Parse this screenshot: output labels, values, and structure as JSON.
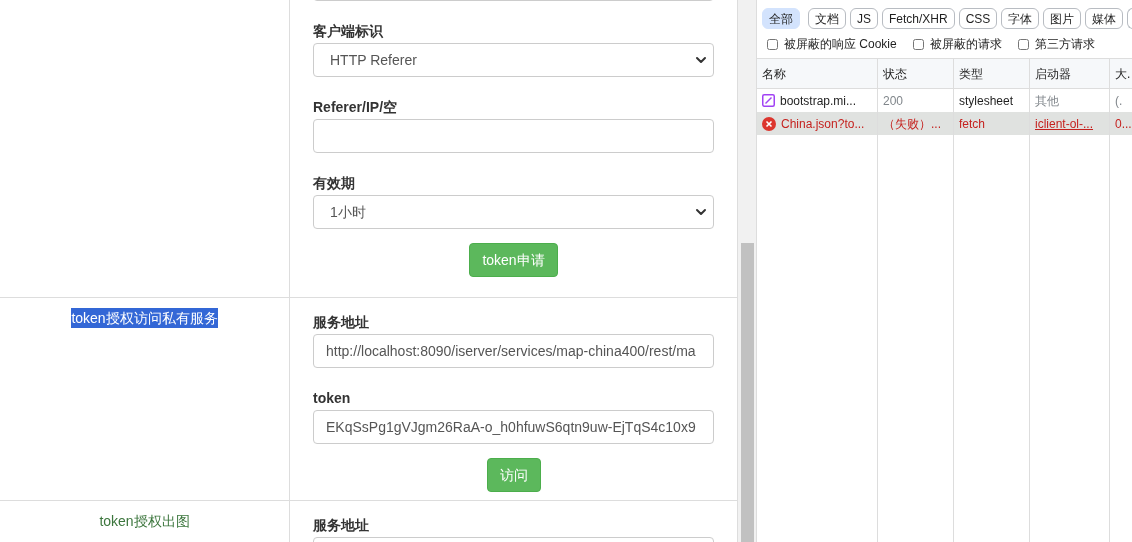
{
  "form_rows": [
    {
      "title": null,
      "fields": [
        {
          "kind": "input"
        },
        {
          "label": "客户端标识",
          "kind": "select",
          "value": "HTTP Referer"
        },
        {
          "label": "Referer/IP/空",
          "kind": "input"
        },
        {
          "label": "有效期",
          "kind": "select",
          "value": "1小时"
        }
      ],
      "button": "token申请"
    },
    {
      "title": "token授权访问私有服务",
      "title_selected": true,
      "fields": [
        {
          "label": "服务地址",
          "kind": "input",
          "value": "http://localhost:8090/iserver/services/map-china400/rest/ma"
        },
        {
          "label": "token",
          "kind": "input",
          "value": "EKqSsPg1gVJgm26RaA-o_h0hfuwS6qtn9uw-EjTqS4c10x9"
        }
      ],
      "button": "访问"
    },
    {
      "title": "token授权出图",
      "title_selected": false,
      "fields": [
        {
          "label": "服务地址",
          "kind": "input"
        }
      ],
      "button": null
    }
  ],
  "devtools": {
    "filters": [
      {
        "label": "全部",
        "selected": true
      },
      {
        "label": "文档",
        "selected": false
      },
      {
        "label": "JS",
        "selected": false
      },
      {
        "label": "Fetch/XHR",
        "selected": false
      },
      {
        "label": "CSS",
        "selected": false
      },
      {
        "label": "字体",
        "selected": false
      },
      {
        "label": "图片",
        "selected": false
      },
      {
        "label": "媒体",
        "selected": false
      }
    ],
    "checkboxes": [
      {
        "label": "被屏蔽的响应 Cookie",
        "checked": false
      },
      {
        "label": "被屏蔽的请求",
        "checked": false
      },
      {
        "label": "第三方请求",
        "checked": false
      }
    ],
    "columns": [
      "名称",
      "状态",
      "类型",
      "启动器",
      "大."
    ],
    "rows": [
      {
        "kind": "stylesheet",
        "selected": false,
        "cells": [
          "bootstrap.mi...",
          "200",
          "stylesheet",
          "其他",
          "(."
        ]
      },
      {
        "kind": "error",
        "selected": true,
        "cells": [
          "China.json?to...",
          "（失败）...",
          "fetch",
          "iclient-ol-...",
          "0..."
        ]
      }
    ]
  }
}
